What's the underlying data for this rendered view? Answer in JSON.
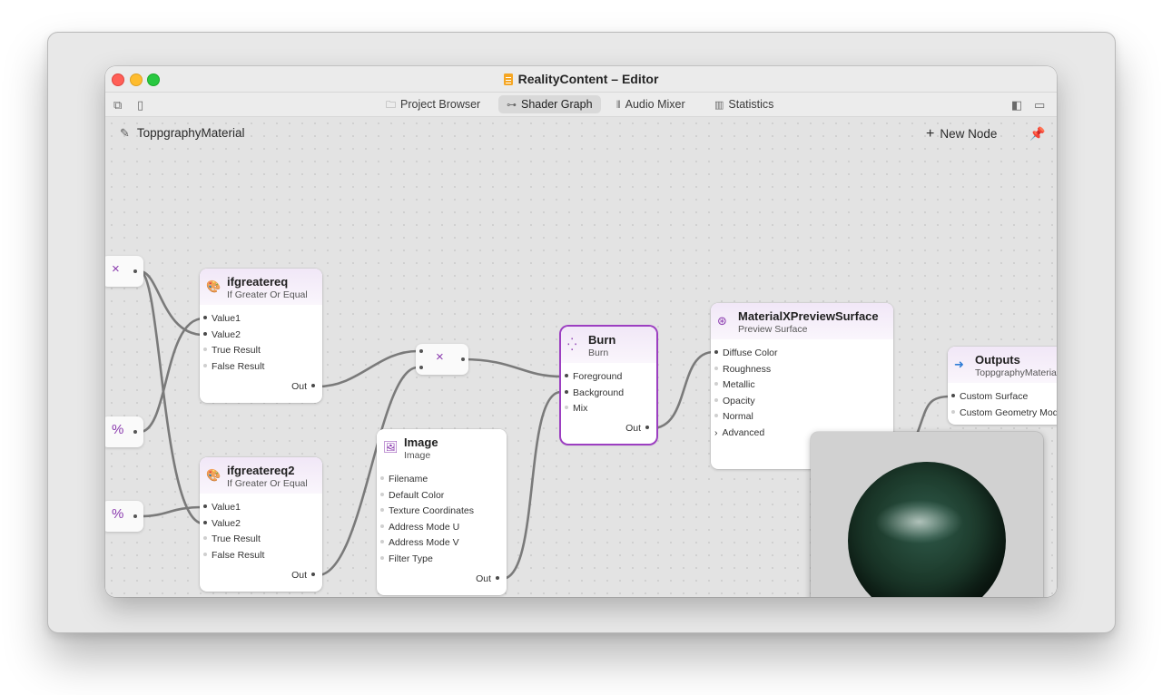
{
  "window": {
    "title": "RealityContent – Editor"
  },
  "toolbar": {
    "tabs": [
      {
        "label": "Project Browser",
        "icon": "folder-icon"
      },
      {
        "label": "Shader Graph",
        "icon": "node-graph-icon",
        "active": true
      },
      {
        "label": "Audio Mixer",
        "icon": "sliders-icon"
      },
      {
        "label": "Statistics",
        "icon": "bar-chart-icon"
      }
    ]
  },
  "canvas": {
    "material_name": "ToppgraphyMaterial",
    "new_node_label": "New Node"
  },
  "nodes": {
    "ifgreatereq": {
      "title": "ifgreatereq",
      "subtitle": "If Greater Or Equal",
      "inputs": [
        "Value1",
        "Value2",
        "True Result",
        "False Result"
      ],
      "output": "Out"
    },
    "ifgreatereq2": {
      "title": "ifgreatereq2",
      "subtitle": "If Greater Or Equal",
      "inputs": [
        "Value1",
        "Value2",
        "True Result",
        "False Result"
      ],
      "output": "Out"
    },
    "image": {
      "title": "Image",
      "subtitle": "Image",
      "inputs": [
        "Filename",
        "Default Color",
        "Texture Coordinates",
        "Address Mode U",
        "Address Mode V",
        "Filter Type"
      ],
      "output": "Out"
    },
    "burn": {
      "title": "Burn",
      "subtitle": "Burn",
      "inputs": [
        "Foreground",
        "Background",
        "Mix"
      ],
      "output": "Out"
    },
    "preview_surface": {
      "title": "MaterialXPreviewSurface",
      "subtitle": "Preview Surface",
      "inputs": [
        "Diffuse Color",
        "Roughness",
        "Metallic",
        "Opacity",
        "Normal"
      ],
      "advanced": "Advanced"
    },
    "outputs": {
      "title": "Outputs",
      "subtitle": "ToppgraphyMateria",
      "inputs": [
        "Custom Surface",
        "Custom Geometry Mod"
      ]
    },
    "mult_top": {
      "glyph": "×"
    },
    "mult_mid": {
      "glyph": "×"
    },
    "pct_a": {
      "glyph": "%"
    },
    "pct_b": {
      "glyph": "%"
    }
  },
  "colors": {
    "accent": "#9c3fc1",
    "wire": "#7a7a7a"
  }
}
